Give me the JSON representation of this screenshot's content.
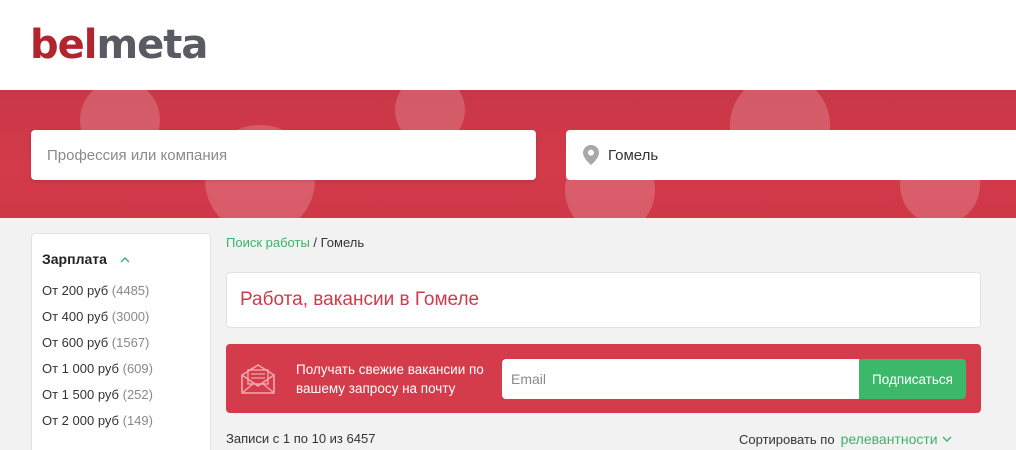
{
  "logo": {
    "part1": "bel",
    "part2": "meta"
  },
  "search": {
    "profession_placeholder": "Профессия или компания",
    "location_value": "Гомель"
  },
  "filter": {
    "title": "Зарплата",
    "items": [
      {
        "label": "От 200 руб",
        "count": "(4485)"
      },
      {
        "label": "От 400 руб",
        "count": "(3000)"
      },
      {
        "label": "От 600 руб",
        "count": "(1567)"
      },
      {
        "label": "От 1 000 руб",
        "count": "(609)"
      },
      {
        "label": "От 1 500 руб",
        "count": "(252)"
      },
      {
        "label": "От 2 000 руб",
        "count": "(149)"
      }
    ]
  },
  "breadcrumb": {
    "link": "Поиск работы",
    "separator": " / ",
    "current": "Гомель"
  },
  "page_title": "Работа, вакансии в Гомеле",
  "subscribe": {
    "text": "Получать свежие вакансии по вашему запросу на почту",
    "email_placeholder": "Email",
    "button": "Подписаться"
  },
  "results": {
    "records": "Записи с 1 по 10 из 6457",
    "sort_label": "Сортировать по",
    "sort_value": "релевантности"
  },
  "colors": {
    "brand_red": "#d43b4b",
    "logo_red": "#b3252e",
    "accent_green": "#3bb36a"
  },
  "icons": {
    "location": "map-pin-icon",
    "mail": "envelope-icon",
    "collapse": "chevron-up-icon",
    "sort": "chevron-down-icon"
  }
}
